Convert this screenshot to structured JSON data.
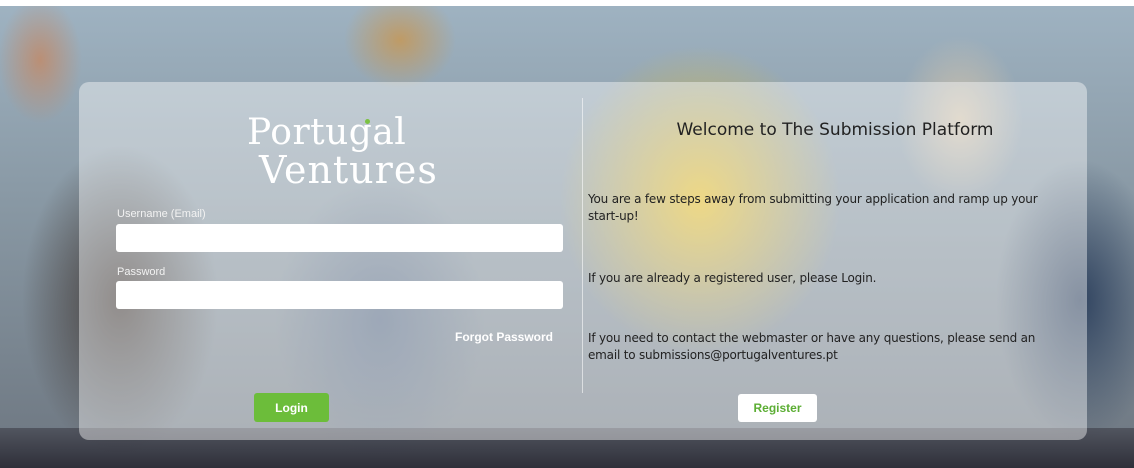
{
  "logo": {
    "line1": "Portugal",
    "line2": "Ventures"
  },
  "login": {
    "username_label": "Username (Email)",
    "username_value": "",
    "password_label": "Password",
    "password_value": "",
    "forgot_label": "Forgot Password",
    "login_label": "Login"
  },
  "welcome": {
    "title": "Welcome to The Submission Platform",
    "p1": "You are a few steps away from submitting your application and ramp up your start-up!",
    "p2": "If you are already a registered user, please Login.",
    "p3": "If you need to contact the webmaster or have any questions, please send an email to submissions@portugalventures.pt",
    "register_label": "Register"
  },
  "colors": {
    "accent_green": "#6cbd3a",
    "register_text": "#5cae34"
  }
}
